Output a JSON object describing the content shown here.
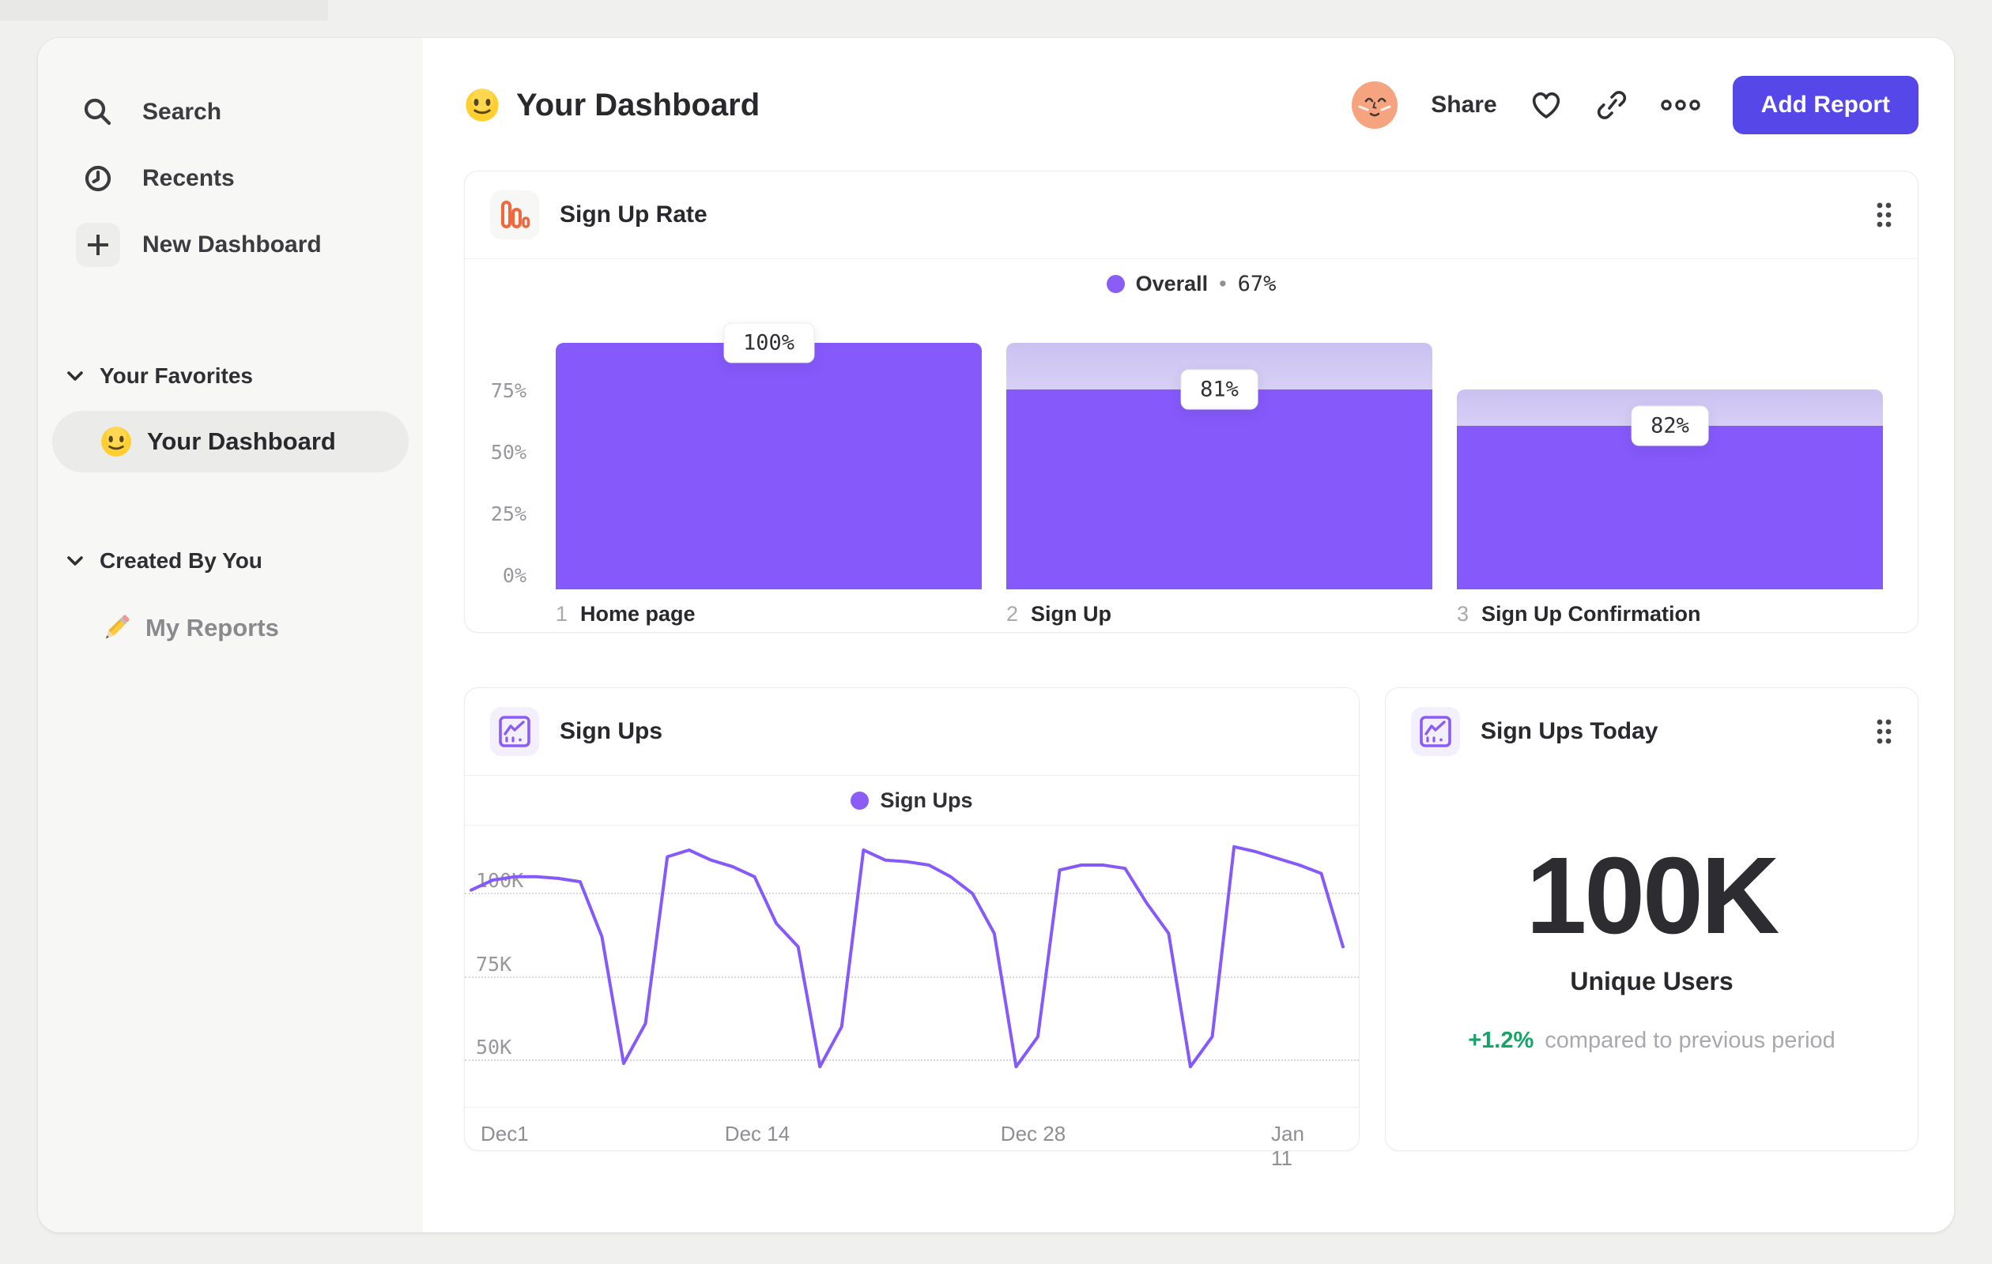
{
  "colors": {
    "accent_purple": "#8659fb",
    "legend_purple": "#8b5cf6",
    "button_indigo": "#5547e8",
    "funnel_icon_orange": "#f2683c",
    "delta_green": "#16a368",
    "sidebar_bg": "#f7f7f5",
    "page_bg": "#f0f0ee"
  },
  "sidebar": {
    "nav": [
      {
        "label": "Search",
        "icon": "search-icon"
      },
      {
        "label": "Recents",
        "icon": "clock-icon"
      },
      {
        "label": "New Dashboard",
        "icon": "plus-icon"
      }
    ],
    "sections": [
      {
        "title": "Your Favorites",
        "items": [
          {
            "label": "Your Dashboard",
            "emoji": "slightly-smiling-face",
            "selected": true
          }
        ]
      },
      {
        "title": "Created By You",
        "items": [
          {
            "label": "My Reports",
            "emoji": "pencil",
            "selected": false
          }
        ]
      }
    ]
  },
  "header": {
    "emoji": "slightly-smiling-face",
    "title": "Your Dashboard",
    "share_label": "Share",
    "add_report_label": "Add Report"
  },
  "cards": {
    "funnel": {
      "title": "Sign Up Rate",
      "legend": {
        "name": "Overall",
        "sep": "•",
        "value": "67%"
      },
      "y_ticks": [
        {
          "label": "75%",
          "pct": 75
        },
        {
          "label": "50%",
          "pct": 50
        },
        {
          "label": "25%",
          "pct": 25
        },
        {
          "label": "0%",
          "pct": 0
        }
      ],
      "steps": [
        {
          "index": "1",
          "label": "Home page",
          "badge": "100%",
          "total_pct": 100,
          "solid_pct": 100
        },
        {
          "index": "2",
          "label": "Sign Up",
          "badge": "81%",
          "total_pct": 100,
          "solid_pct": 81
        },
        {
          "index": "3",
          "label": "Sign Up Confirmation",
          "badge": "82%",
          "total_pct": 81,
          "solid_pct": 66.4
        }
      ]
    },
    "line": {
      "title": "Sign Ups",
      "legend": "Sign Ups",
      "y_ticks": [
        {
          "label": "100K",
          "value": 100
        },
        {
          "label": "75K",
          "value": 75
        },
        {
          "label": "50K",
          "value": 50
        }
      ],
      "x_ticks": [
        "Dec1",
        "Dec 14",
        "Dec 28",
        "Jan 11"
      ]
    },
    "metric": {
      "title": "Sign Ups Today",
      "value": "100K",
      "label": "Unique Users",
      "delta": "+1.2%",
      "delta_caption": "compared to previous period"
    }
  },
  "chart_data": [
    {
      "type": "bar",
      "title": "Sign Up Rate",
      "categories": [
        "Home page",
        "Sign Up",
        "Sign Up Confirmation"
      ],
      "series": [
        {
          "name": "Overall",
          "values": [
            100,
            81,
            82
          ]
        }
      ],
      "cumulative_pct": [
        100,
        81,
        66.4
      ],
      "overall_conversion": "67%",
      "ylabel": "%",
      "ylim": [
        0,
        100
      ],
      "y_ticks": [
        "75%",
        "50%",
        "25%",
        "0%"
      ],
      "legend_position": "top-center",
      "grid": false
    },
    {
      "type": "line",
      "title": "Sign Ups",
      "series": [
        {
          "name": "Sign Ups",
          "unit": "K",
          "values": [
            97,
            100,
            101,
            101,
            100.5,
            99.5,
            83,
            45,
            57,
            107,
            109,
            106,
            104,
            101,
            87,
            80,
            44,
            56,
            109,
            106,
            105.5,
            104.5,
            101,
            96,
            84,
            44,
            53,
            103,
            104.5,
            104.5,
            103.5,
            93,
            84,
            44,
            53,
            110,
            108.5,
            106.5,
            104.5,
            102,
            80
          ]
        }
      ],
      "x_ticks": [
        "Dec1",
        "Dec 14",
        "Dec 28",
        "Jan 11"
      ],
      "y_ticks": [
        "100K",
        "75K",
        "50K"
      ],
      "ylim": [
        31,
        114
      ],
      "grid": "dotted-horizontal",
      "legend_position": "top-center"
    }
  ]
}
